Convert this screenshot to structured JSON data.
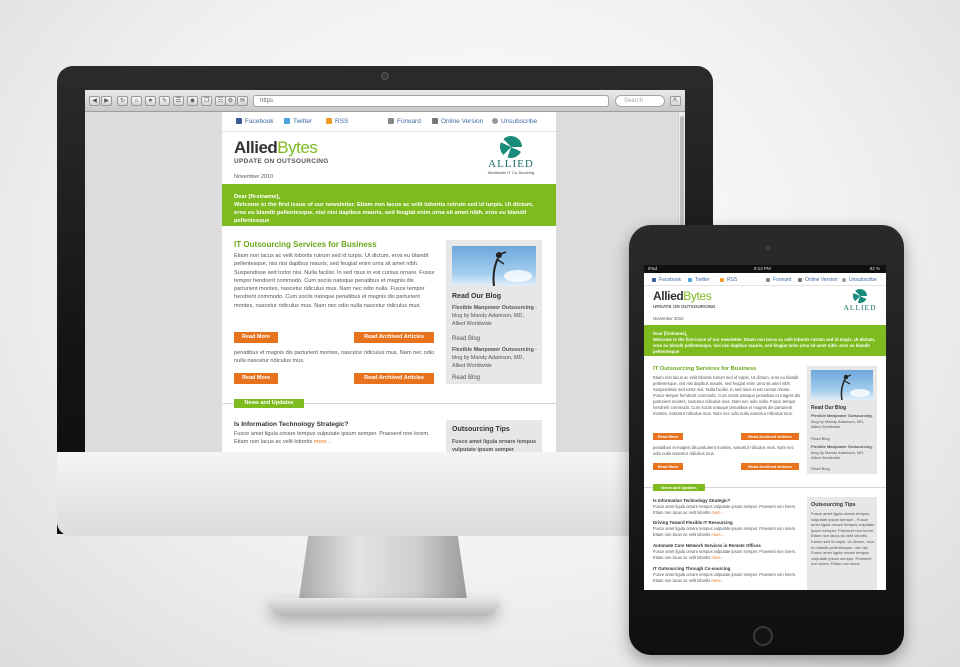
{
  "browser": {
    "url": "https",
    "search_placeholder": "Search",
    "nav_buttons": [
      "◀",
      "▶",
      "↻",
      "⌂",
      "★",
      "✎",
      "☰",
      "◉",
      "❒",
      "☷",
      "⚙",
      "✉",
      "⇱"
    ]
  },
  "colors": {
    "brand_green": "#7dbb1f",
    "accent_orange": "#e8731f",
    "link_blue": "#3b6aa0",
    "logo_teal": "#1a6e66"
  },
  "newsletter": {
    "topbar": {
      "facebook": "Facebook",
      "twitter": "Twitter",
      "rss": "RSS",
      "forward": "Forward",
      "online_version": "Online Version",
      "unsubscribe": "Unsubscribe"
    },
    "brand_part1": "Allied",
    "brand_part2": "Bytes",
    "subtitle": "UPDATE ON OUTSOURCING",
    "date": "November 2010",
    "logo_word": "ALLIED",
    "logo_tagline": "Worldwide IT Co-Sourcing",
    "banner_greeting": "Dear [firstname],",
    "banner_text": "Welcome to the first issue of our newsletter. Etiam non lacus ac velit lobortis rutrum sed id turpis. Ut dictum, eros eu blandit pellentesque, nisi nisi dapibus mauris, sed feugiat enim urna sit amet nibh. eros eu blandit pellentesque",
    "article_title": "IT Outsourcing Services for Business",
    "article_body": "Etiam non lacus ac velit lobortis rutrum sed id turpis. Ut dictum, eros eu blandit pellentesque, nisi nisi dapibus mauris, sed feugiat enim urna sit amet nibh. Suspendisse sed tortor nisi. Nulla facilisi. In sed risus in est cursus ornare. Fusce tempor hendrerit commodo. Cum sociis natoque penatibus et magnis dis parturient montes, nascetur ridiculus mus. Nam nec odio nulla. Fusce tempor hendrerit commodo. Cum sociis natoque penatibus et magnis dis parturient montes, nascetur ridiculus mus. Nam nec odio nulla nascetur ridiculus mus.",
    "article_body2": "penatibus et magnis dis parturient montes, nascetur ridiculus mus. Nam nec odio nulla nascetur ridiculus mus.",
    "read_more": "Read More",
    "read_archived": "Read Archived Articles",
    "blog": {
      "heading": "Read Our Blog",
      "post1_title": "Flexible Manpower Outsourcing",
      "post1_meta": "- blog by Mandy Adamson, MD, Allied Worldwide",
      "read_blog": "Read Blog",
      "post2_title": "Flexible Manpower Outsourcing",
      "post2_meta": "- blog by Mandy Adamson, MD, Allied Worldwide"
    },
    "news_section": "News and Updates",
    "news1_title": "Is Information Technology Strategic?",
    "news1_body": "Fusce amet ligula ornare tempus vulputate ipsum semper. Praesent non lorem. Etiam non lacus ac velit lobortis",
    "more": "more...",
    "tips_heading": "Outsourcing Tips",
    "tips_lead": "Fusce amet ligula ornare tempus vulputate ipsum semper"
  },
  "tablet": {
    "status_left": "iPad",
    "status_center": "9:14 PM",
    "status_right": "82 %",
    "news": [
      {
        "title": "Is Information Technology Strategic?",
        "body": "Fusce amet ligula ornare tempus vulputate ipsum semper. Praesent non lorem. Etiam non lacus ac velit lobortis"
      },
      {
        "title": "Driving Toward Flexible IT Resourcing",
        "body": "Fusce amet ligula ornare tempus vulputate ipsum semper. Praesent non lorem. Etiam non lacus ac velit lobortis"
      },
      {
        "title": "Automate Core Network Services in Remote Offices",
        "body": "Fusce amet ligula ornare tempus vulputate ipsum semper. Praesent non lorem. Etiam non lacus ac velit lobortis"
      },
      {
        "title": "IT Outsourcing Through Co-sourcing",
        "body": "Fusce amet ligula ornare tempus vulputate ipsum semper. Praesent non lorem. Etiam non lacus ac velit lobortis"
      }
    ],
    "tips_body": "Fusce amet ligula ornare tempus vulputate ipsum semper - Fusce amet ligula ornare tempus vulputate ipsum semper. Praesent non lorem. Etiam non lacus ac velit lobortis rutrum sed id turpis. Ut dictum, eros eu blandit pellentesque, nisi nisi. Fusce amet ligula ornare tempus vulputate ipsum semper. Praesent non lorem. Etiam non lacus"
  }
}
